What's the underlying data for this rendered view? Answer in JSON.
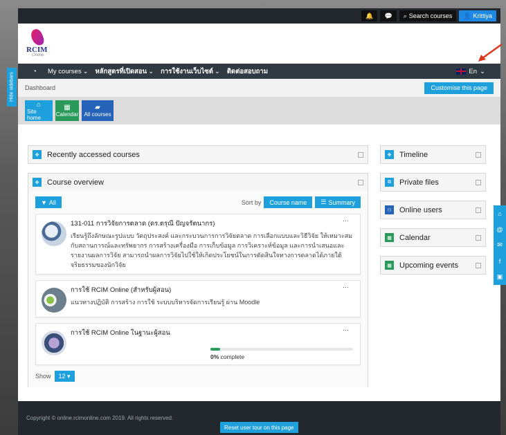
{
  "topbar": {
    "bell_icon": "bell-icon",
    "chat_icon": "chat-icon",
    "search_label": "Search courses",
    "user_label": "Krittiya"
  },
  "header": {
    "logo_text": "RCIM",
    "logo_sub": "Online"
  },
  "navbar": {
    "items": [
      {
        "label": "My courses"
      },
      {
        "label": "หลักสูตรที่เปิดสอน"
      },
      {
        "label": "การใช้งานเว็บไซต์"
      },
      {
        "label": "ติดต่อสอบถาม"
      }
    ],
    "language": "En"
  },
  "breadcrumb": {
    "current": "Dashboard",
    "customise_label": "Customise this page"
  },
  "quicklinks": [
    {
      "label": "Site home"
    },
    {
      "label": "Calendar"
    },
    {
      "label": "All courses"
    }
  ],
  "blocks": {
    "recent_title": "Recently accessed courses",
    "overview_title": "Course overview",
    "right": [
      {
        "title": "Timeline"
      },
      {
        "title": "Private files"
      },
      {
        "title": "Online users"
      },
      {
        "title": "Calendar"
      },
      {
        "title": "Upcoming events"
      }
    ]
  },
  "overview": {
    "filter_label": "All",
    "sort_by_label": "Sort by",
    "sort_option": "Course name",
    "view_option": "Summary",
    "courses": [
      {
        "title": "131-011 การวิจัยการตลาด (ดร.ตรุณี ปัญจรัตนากร)",
        "desc": "เรียนรู้ถึงลักษณะรูปแบบ วัตถุประสงค์ และกระบวนการการวิจัยตลาด การเลือกแบบและวิธีวิจัย ให้เหมาะสมกับสถานการณ์และทรัพยากร การสร้างเครื่องมือ การเก็บข้อมูล การวิเคราะห์ข้อมูล และการนำเสนอและรายงานผลการวิจัย สามารถนำผลการวิจัยไปใช้ให้เกิดประโยชน์ในการตัดสินใจทางการตลาดได้ภายใต้จริยธรรมของนักวิจัย"
      },
      {
        "title": "การใช้ RCIM Online (สำหรับผู้สอน)",
        "desc": "แนวทางปฏิบัติ การสร้าง การใช้ ระบบบริหารจัดการเรียนรู้ ผ่าน Moodle"
      },
      {
        "title": "การใช้ RCIM Online ในฐานะผู้สอน",
        "progress_percent": "0%",
        "progress_suffix": " complete",
        "progress_value": 0
      }
    ],
    "show_label": "Show",
    "show_value": "12"
  },
  "footer": {
    "copyright": "Copyright © online.rcimonline.com 2019. All rights reserved.",
    "reset_label": "Reset user tour on this page"
  },
  "sidebar_toggle": "Hide sidebars",
  "colors": {
    "accent": "#1ea0dc",
    "navbar": "#2f3a42",
    "calendar_green": "#2a9a5b",
    "allcourses_blue": "#2563b8"
  }
}
